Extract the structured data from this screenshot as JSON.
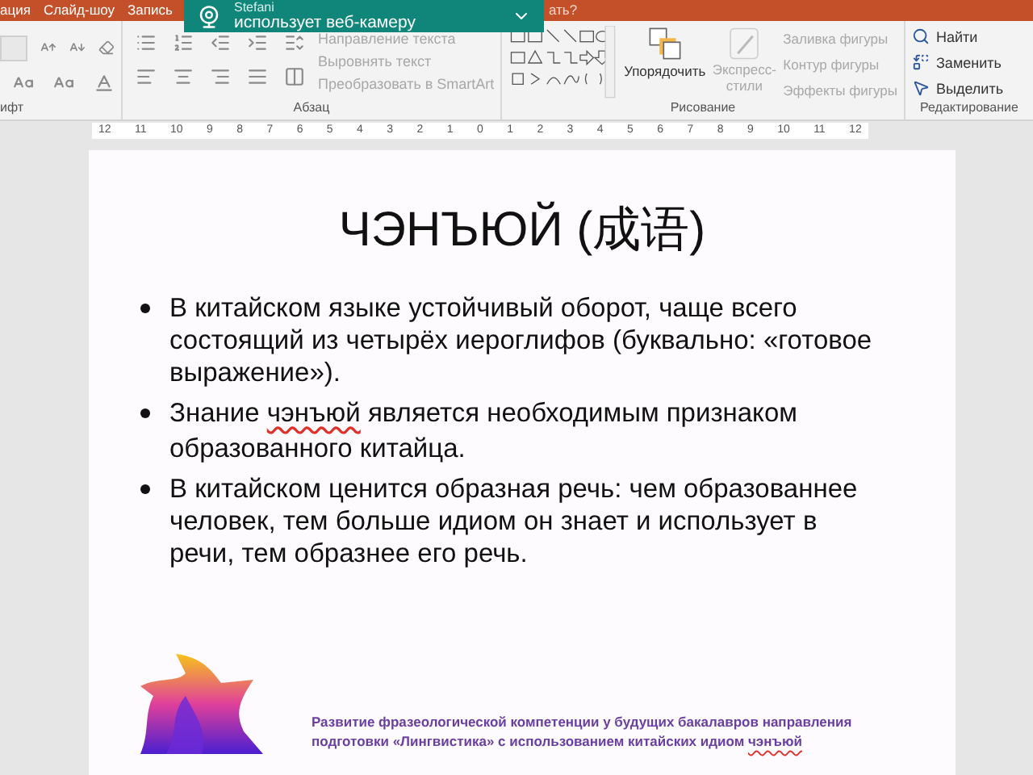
{
  "tabs": [
    {
      "label": "ация",
      "selected": false
    },
    {
      "label": "Слайд-шоу",
      "selected": false
    },
    {
      "label": "Запись",
      "selected": false
    }
  ],
  "tell_me": "ать?",
  "notification": {
    "name": "Stefani",
    "message": "использует веб-камеру"
  },
  "ribbon": {
    "groups": [
      {
        "kind": "font",
        "label": "ифт"
      },
      {
        "kind": "paragraph",
        "label": "Абзац",
        "commands": [
          {
            "label": "Направление текста",
            "disabled": true
          },
          {
            "label": "Выровнять текст",
            "disabled": true
          },
          {
            "label": "Преобразовать в SmartArt",
            "disabled": true
          }
        ]
      },
      {
        "kind": "drawing",
        "label": "Рисование",
        "arrange": "Упорядочить",
        "styles": {
          "label": "Экспресс-стили",
          "disabled": true
        },
        "commands": [
          {
            "label": "Заливка фигуры",
            "disabled": true
          },
          {
            "label": "Контур фигуры",
            "disabled": true
          },
          {
            "label": "Эффекты фигуры",
            "disabled": true
          }
        ]
      },
      {
        "kind": "editing",
        "label": "Редактирование",
        "commands": [
          {
            "label": "Найти"
          },
          {
            "label": "Заменить"
          },
          {
            "label": "Выделить"
          }
        ]
      }
    ]
  },
  "ruler": [
    "12",
    "11",
    "10",
    "9",
    "8",
    "7",
    "6",
    "5",
    "4",
    "3",
    "2",
    "1",
    "0",
    "1",
    "2",
    "3",
    "4",
    "5",
    "6",
    "7",
    "8",
    "9",
    "10",
    "11",
    "12"
  ],
  "slide": {
    "title": "ЧЭНЪЮЙ (成语)",
    "bullets": [
      [
        {
          "text": "В китайском языке устойчивый оборот, чаще всего состоящий из четырёх иероглифов (буквально: «готовое выражение»).",
          "flagged": false
        }
      ],
      [
        {
          "text": "Знание ",
          "flagged": false
        },
        {
          "text": "чэнъюй",
          "flagged": true
        },
        {
          "text": " является необходимым признаком образованного китайца.",
          "flagged": false
        }
      ],
      [
        {
          "text": "В китайском ценится образная речь: чем образованнее человек, тем больше идиом он знает и использует в речи, тем образнее его речь.",
          "flagged": false
        }
      ]
    ],
    "footer": [
      {
        "text": "Развитие фразеологической компетенции у будущих бакалавров направления подготовки «Лингвистика» с использованием китайских идиом ",
        "flagged": false
      },
      {
        "text": "чэнъюй",
        "flagged": true
      }
    ]
  }
}
